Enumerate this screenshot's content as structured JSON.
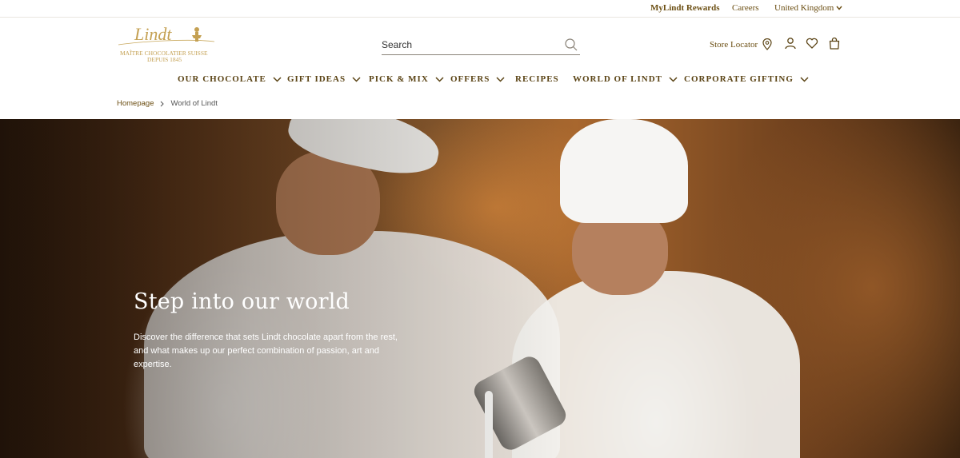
{
  "topbar": {
    "rewards": "MyLindt Rewards",
    "careers": "Careers",
    "country": "United Kingdom"
  },
  "logo": {
    "wordmark": "Lindt",
    "tagline_line1": "MAÎTRE CHOCOLATIER SUISSE",
    "tagline_line2": "DEPUIS 1845"
  },
  "search": {
    "placeholder": "Search"
  },
  "header": {
    "store_locator": "Store Locator"
  },
  "nav": {
    "items": [
      {
        "label": "OUR CHOCOLATE",
        "has_dropdown": true
      },
      {
        "label": "GIFT IDEAS",
        "has_dropdown": true
      },
      {
        "label": "PICK & MIX",
        "has_dropdown": true
      },
      {
        "label": "OFFERS",
        "has_dropdown": true
      },
      {
        "label": "RECIPES",
        "has_dropdown": false
      },
      {
        "label": "WORLD OF LINDT",
        "has_dropdown": true
      },
      {
        "label": "CORPORATE GIFTING",
        "has_dropdown": true
      }
    ]
  },
  "breadcrumb": {
    "home": "Homepage",
    "current": "World of Lindt"
  },
  "hero": {
    "title": "Step into our world",
    "text": "Discover the difference that sets Lindt chocolate apart from the rest, and what makes up our perfect combination of passion, art and expertise."
  },
  "colors": {
    "brand_gold": "#b8974a",
    "brand_brown": "#5a4314"
  }
}
